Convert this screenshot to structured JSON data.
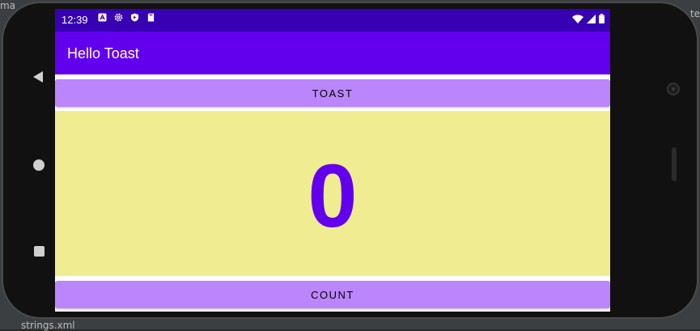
{
  "ide": {
    "top_left_text": "ma",
    "right_text": "te",
    "bottom_file": "strings.xml"
  },
  "status_bar": {
    "time": "12:39",
    "left_icons": [
      "a-icon",
      "gear-icon",
      "shield-icon",
      "sd-card-icon"
    ],
    "right_icons": [
      "wifi-icon",
      "signal-icon",
      "battery-icon"
    ]
  },
  "app_bar": {
    "title": "Hello Toast"
  },
  "buttons": {
    "toast_label": "TOAST",
    "count_label": "COUNT"
  },
  "counter": {
    "value": "0"
  },
  "colors": {
    "status_bar": "#3700b3",
    "app_bar": "#6200ee",
    "button": "#bb86fc",
    "count_background": "#f0ec92",
    "count_text": "#6200ee"
  }
}
